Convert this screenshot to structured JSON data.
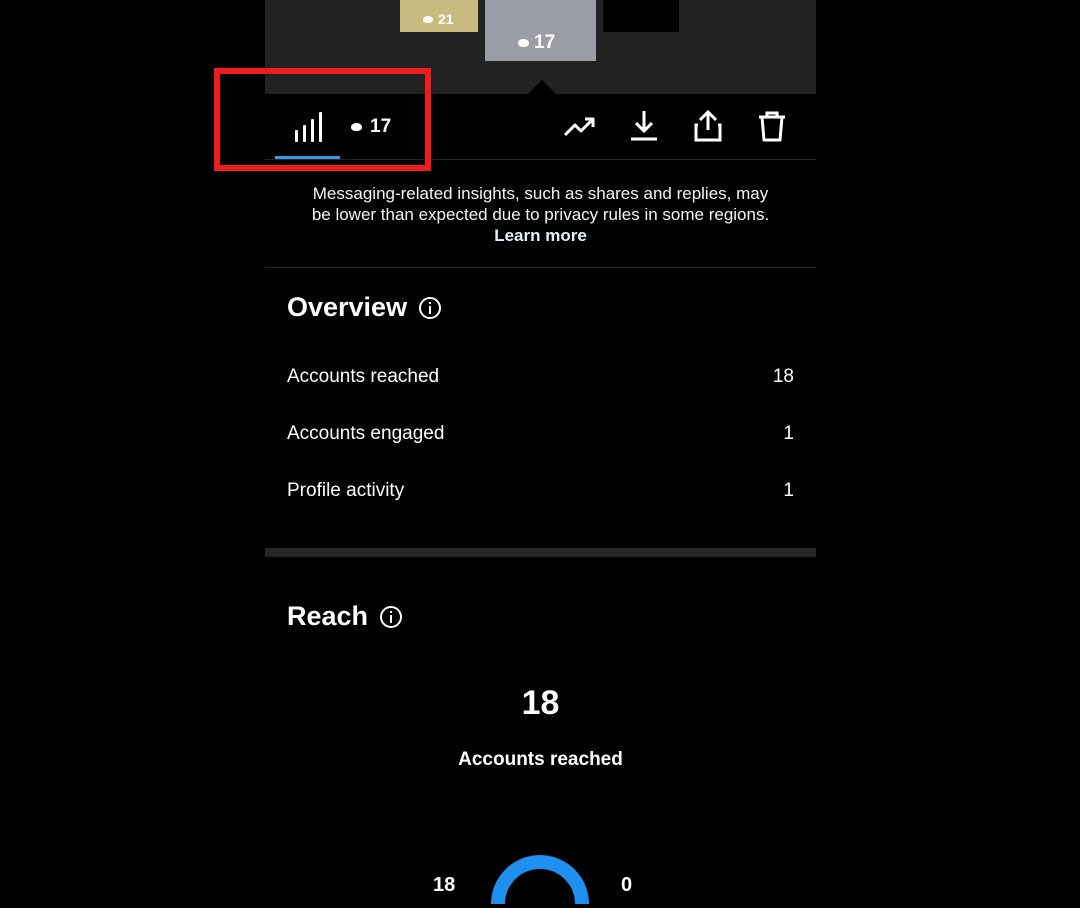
{
  "preview": {
    "thumbs": [
      {
        "views": "21",
        "bg": "#c8bb80"
      },
      {
        "views": "17",
        "bg": "#9a9ca6"
      },
      {
        "bg": "#000000"
      }
    ]
  },
  "toolbar": {
    "stats_tab": {
      "icon": "bar-chart-icon",
      "active": true
    },
    "view_count": "17",
    "actions": [
      {
        "name": "boost",
        "icon": "trending-up-icon"
      },
      {
        "name": "download",
        "icon": "download-icon"
      },
      {
        "name": "share",
        "icon": "share-icon"
      },
      {
        "name": "delete",
        "icon": "trash-icon"
      }
    ]
  },
  "notice": {
    "text": "Messaging-related insights, such as shares and replies, may be lower than expected due to privacy rules in some regions.",
    "link": "Learn more"
  },
  "overview": {
    "title": "Overview",
    "rows": [
      {
        "label": "Accounts reached",
        "value": "18"
      },
      {
        "label": "Accounts engaged",
        "value": "1"
      },
      {
        "label": "Profile activity",
        "value": "1"
      }
    ]
  },
  "reach": {
    "title": "Reach",
    "value": "18",
    "label": "Accounts reached",
    "donut_left": "18",
    "donut_right": "0",
    "donut_color": "#1e90f0"
  },
  "colors": {
    "accent": "#3897f0",
    "highlight": "#ee1c1c",
    "background": "#000000"
  }
}
